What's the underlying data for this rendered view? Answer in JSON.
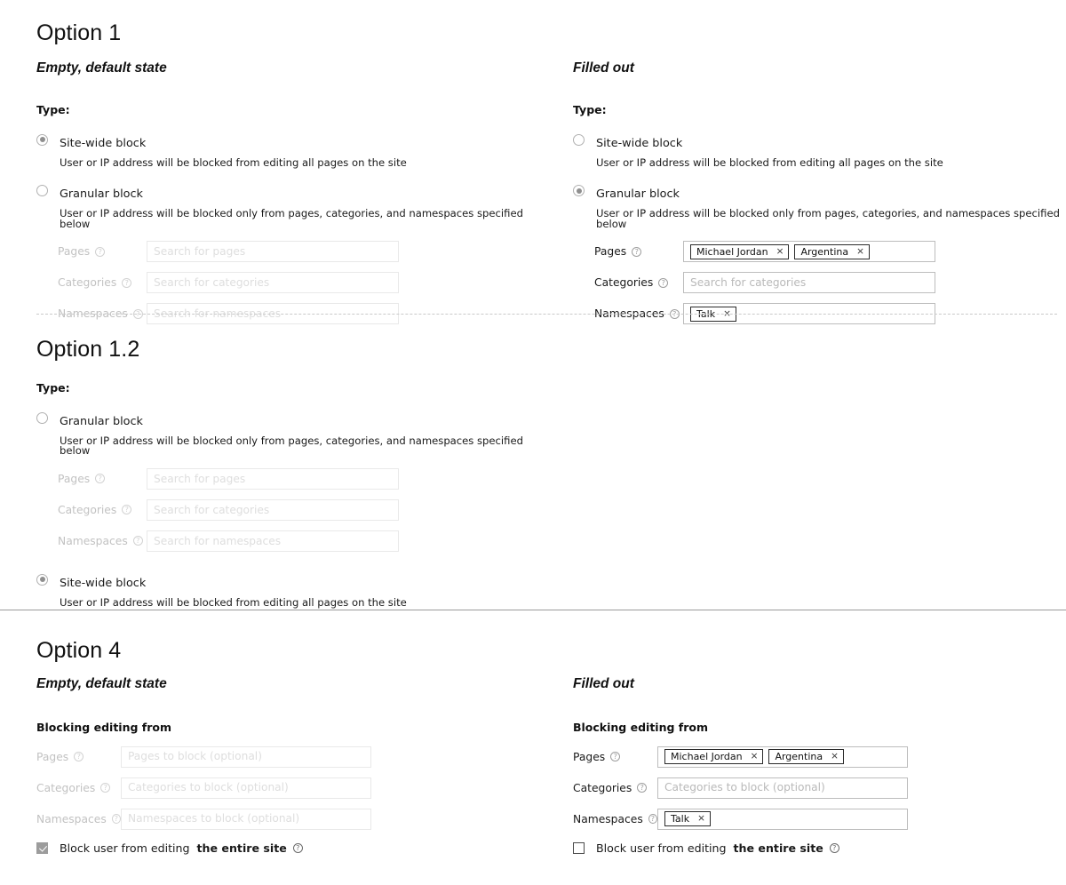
{
  "theme": {
    "background": "#ffffff",
    "text": "#1a1a1a",
    "muted_text": "#c2c2c2",
    "placeholder": "#b9b9b9",
    "placeholder_faint": "#dedede",
    "input_border": "#bdbdbd",
    "input_border_disabled": "#e9e9e9",
    "chip_border": "#2b2b2b",
    "radio_border": "#b0b0b0",
    "radio_dot": "#8f8f8f",
    "checkbox_checked": "#9c9c9c",
    "divider_dashed": "#c9c9c9",
    "divider_solid": "#9a9a9a"
  },
  "icons": {
    "help": "help-circle-icon",
    "chip_remove": "×",
    "question_glyph": "?"
  },
  "labels": {
    "type": "Type:",
    "blocking_editing_from": "Blocking editing from",
    "pages": "Pages",
    "categories": "Categories",
    "namespaces": "Namespaces"
  },
  "radio_options": {
    "sitewide": {
      "label": "Site-wide block",
      "description": "User or IP address will be blocked from editing all pages on the site"
    },
    "granular": {
      "label": "Granular block",
      "description": "User or IP address will be blocked only from pages, categories, and namespaces specified below"
    }
  },
  "placeholders": {
    "search_pages": "Search for pages",
    "search_categories": "Search for categories",
    "search_namespaces": "Search for namespaces",
    "block_pages": "Pages to block (optional)",
    "block_categories": "Categories to block (optional)",
    "block_namespaces": "Namespaces to block (optional)"
  },
  "chips": {
    "michael_jordan": "Michael Jordan",
    "argentina": "Argentina",
    "talk": "Talk"
  },
  "checkbox": {
    "lead": "Block user from editing",
    "emphasis": "the entire site"
  },
  "sections": {
    "option1": {
      "title": "Option 1",
      "left_state": "Empty, default state",
      "right_state": "Filled out",
      "left": {
        "sitewide_selected": true,
        "granular_selected": false,
        "fields_disabled": true
      },
      "right": {
        "sitewide_selected": false,
        "granular_selected": true,
        "fields_disabled": false
      }
    },
    "option12": {
      "title": "Option 1.2",
      "granular_selected": false,
      "sitewide_selected": true,
      "fields_disabled": true
    },
    "option4": {
      "title": "Option 4",
      "left_state": "Empty, default state",
      "right_state": "Filled out",
      "left": {
        "fields_disabled": true,
        "entire_site_checked": true
      },
      "right": {
        "fields_disabled": false,
        "entire_site_checked": false
      }
    }
  }
}
